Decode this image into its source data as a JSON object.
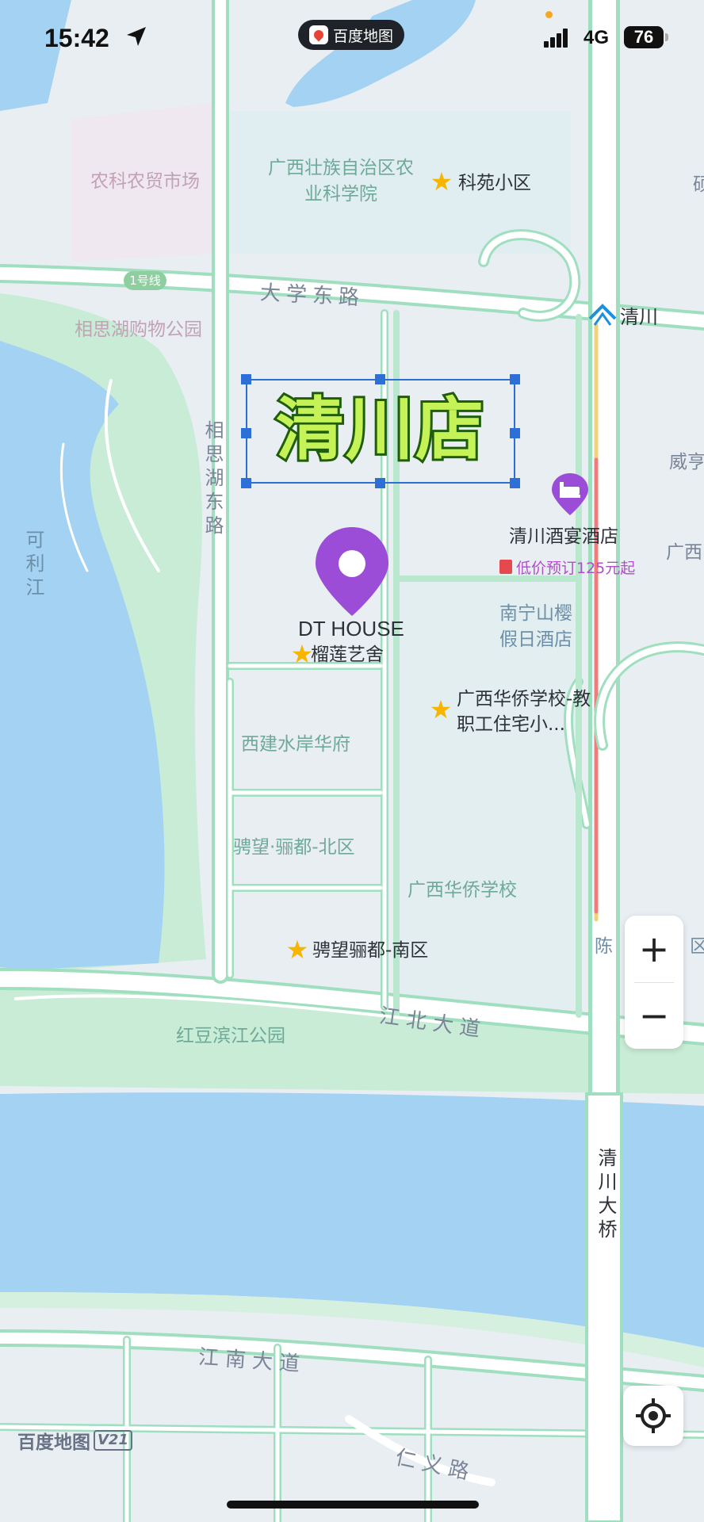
{
  "status_bar": {
    "time": "15:42",
    "app_name": "百度地图",
    "network": "4G",
    "battery": "76"
  },
  "map": {
    "transit_line": "1号线",
    "metro_station": "清川",
    "streets": {
      "daxue_east": "大学东路",
      "xiangsihu_east": "相思湖东路",
      "jiangbei": "江北大道",
      "jiangnan": "江南大道",
      "renyi": "仁义路",
      "qingchuan_bridge": "清川大桥",
      "river": "可利江"
    },
    "areas": {
      "market": "农科农贸市场",
      "academy": "广西壮族自治区农业科学院",
      "park_mall": "相思湖购物公园",
      "xijian": "西建水岸华府",
      "pinwang_north": "骋望·骊都-北区",
      "school": "广西华侨学校",
      "hongdou_park": "红豆滨江公园",
      "shanying_hotel": "南宁山樱假日酒店",
      "weiheng": "威亨",
      "guangxi_edge": "广西",
      "chen_edge": "陈",
      "qu_edge": "区",
      "edge_right": "硕"
    },
    "pois": {
      "keyuan": "科苑小区",
      "liulian": "榴莲艺舍",
      "huaqiao_dorm": "广西华侨学校-教职工住宅小...",
      "pinwang_south": "骋望骊都-南区"
    },
    "hotel": {
      "name": "清川酒宴酒店",
      "promo": "低价预订125元起"
    },
    "selected_place": "DT HOUSE",
    "store_label": "清川店"
  },
  "controls": {
    "zoom_in": "+",
    "zoom_out": "−"
  },
  "watermark": {
    "brand": "百度地图",
    "version": "V21"
  },
  "colors": {
    "water": "#a3d2f3",
    "green": "#c9ecd6",
    "road_outline": "#9fdfbf",
    "block": "#e9eef3",
    "pin_purple": "#9b4dd8",
    "selection_blue": "#2d6fd6",
    "title_fill": "#c4f257",
    "title_stroke": "#1f5d0a"
  }
}
